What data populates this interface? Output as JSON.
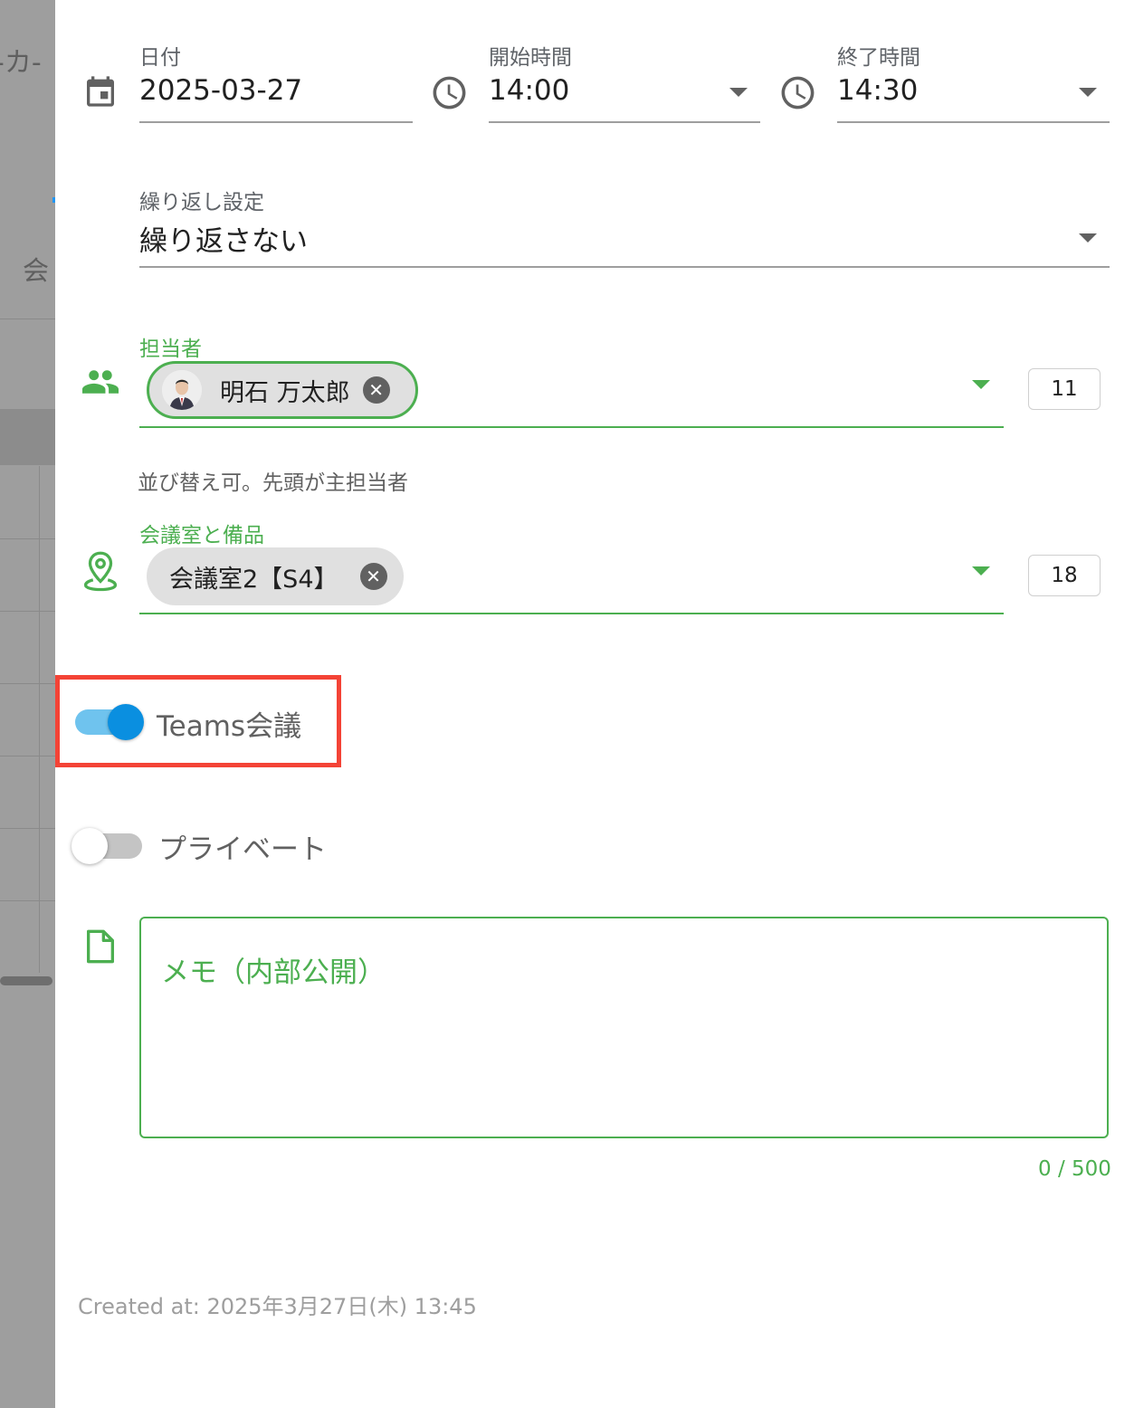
{
  "background": {
    "header_text": "-カ-",
    "row_text": "会"
  },
  "date": {
    "label": "日付",
    "value": "2025-03-27",
    "icon": "calendar-icon"
  },
  "start_time": {
    "label": "開始時間",
    "value": "14:00",
    "icon": "clock-icon"
  },
  "end_time": {
    "label": "終了時間",
    "value": "14:30",
    "icon": "clock-icon"
  },
  "repeat": {
    "label": "繰り返し設定",
    "value": "繰り返さない"
  },
  "assignee": {
    "label": "担当者",
    "chip": "明石 万太郎",
    "count": "11",
    "hint": "並び替え可。先頭が主担当者",
    "icon": "people-icon"
  },
  "rooms": {
    "label": "会議室と備品",
    "chip": "会議室2【S4】",
    "count": "18",
    "icon": "location-pin-icon"
  },
  "teams_toggle": {
    "label": "Teams会議",
    "on": true
  },
  "private_toggle": {
    "label": "プライベート",
    "on": false
  },
  "memo": {
    "placeholder": "メモ（内部公開）",
    "counter": "0 / 500",
    "icon": "document-icon"
  },
  "footer": {
    "created_at": "Created at: 2025年3月27日(木) 13:45"
  },
  "colors": {
    "accent_green": "#4caf50",
    "toggle_blue": "#0a8fe0",
    "highlight_red": "#f44336"
  }
}
